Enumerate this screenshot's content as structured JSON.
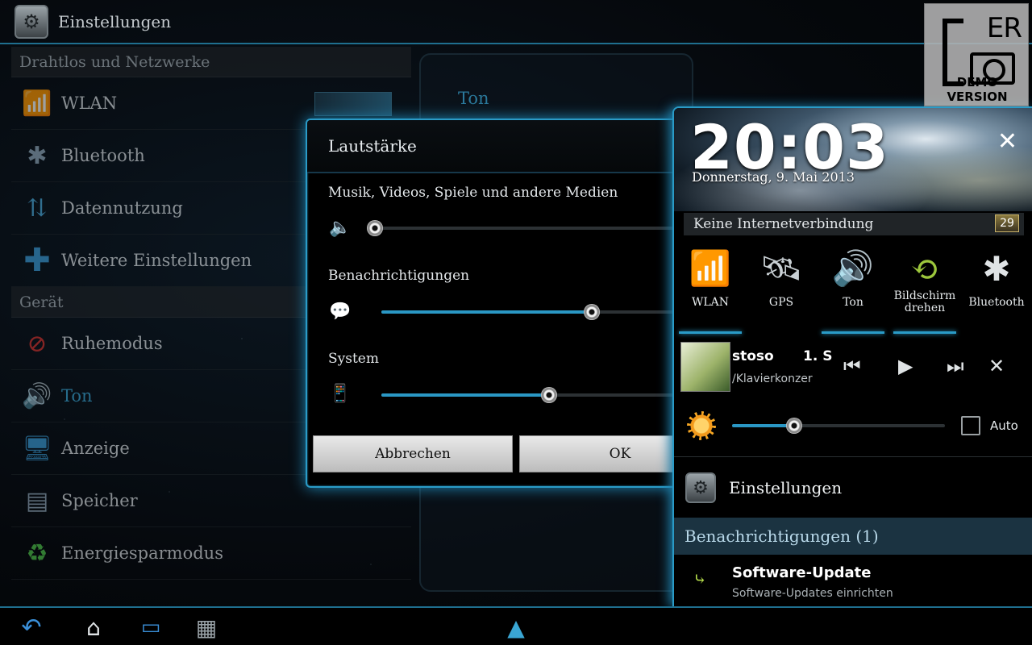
{
  "app": {
    "title": "Einstellungen"
  },
  "sidebar": {
    "sections": [
      {
        "label": "Drahtlos und Netzwerke"
      },
      {
        "label": "Gerät"
      }
    ],
    "items": [
      {
        "label": "WLAN",
        "icon": "wifi-icon"
      },
      {
        "label": "Bluetooth",
        "icon": "bluetooth-icon"
      },
      {
        "label": "Datennutzung",
        "icon": "data-usage-icon"
      },
      {
        "label": "Weitere Einstellungen",
        "icon": "plus-icon"
      },
      {
        "label": "Ruhemodus",
        "icon": "no-entry-icon"
      },
      {
        "label": "Ton",
        "icon": "speaker-icon",
        "selected": true
      },
      {
        "label": "Anzeige",
        "icon": "display-icon"
      },
      {
        "label": "Speicher",
        "icon": "storage-icon"
      },
      {
        "label": "Energiesparmodus",
        "icon": "battery-saver-icon"
      }
    ]
  },
  "detail": {
    "title": "Ton"
  },
  "dialog": {
    "title": "Lautstärke",
    "sliders": [
      {
        "label": "Musik, Videos, Spiele und andere Medien",
        "icon": "speaker-icon",
        "value": 0.0
      },
      {
        "label": "Benachrichtigungen",
        "icon": "notification-bubble-icon",
        "value": 0.69
      },
      {
        "label": "System",
        "icon": "phone-speaker-icon",
        "value": 0.55
      }
    ],
    "cancel_label": "Abbrechen",
    "ok_label": "OK"
  },
  "panel": {
    "time": "20:03",
    "date": "Donnerstag, 9. Mai 2013",
    "network_status": "Keine Internetverbindung",
    "badge": "29",
    "quick_settings": [
      {
        "label": "WLAN",
        "icon": "wifi-icon",
        "active": true
      },
      {
        "label": "GPS",
        "icon": "satellite-icon",
        "active": false
      },
      {
        "label": "Ton",
        "icon": "speaker-icon",
        "active": true
      },
      {
        "label": "Bildschirm drehen",
        "icon": "rotate-screen-icon",
        "active": true
      },
      {
        "label": "Bluetooth",
        "icon": "bluetooth-icon",
        "active": false
      }
    ],
    "media": {
      "title": "stoso",
      "track_number": "1. S",
      "subtitle": "/Klavierkonzer"
    },
    "brightness": {
      "value": 0.29,
      "auto_label": "Auto"
    },
    "settings_label": "Einstellungen",
    "notifications_header": "Benachrichtigungen (1)",
    "notification": {
      "title": "Software-Update",
      "subtitle": "Software-Updates einrichten"
    }
  },
  "watermark": {
    "letters": "ER",
    "text": "DEMO VERSION"
  },
  "colors": {
    "accent": "#2a9bc7",
    "selected": "#3aa6d4"
  }
}
